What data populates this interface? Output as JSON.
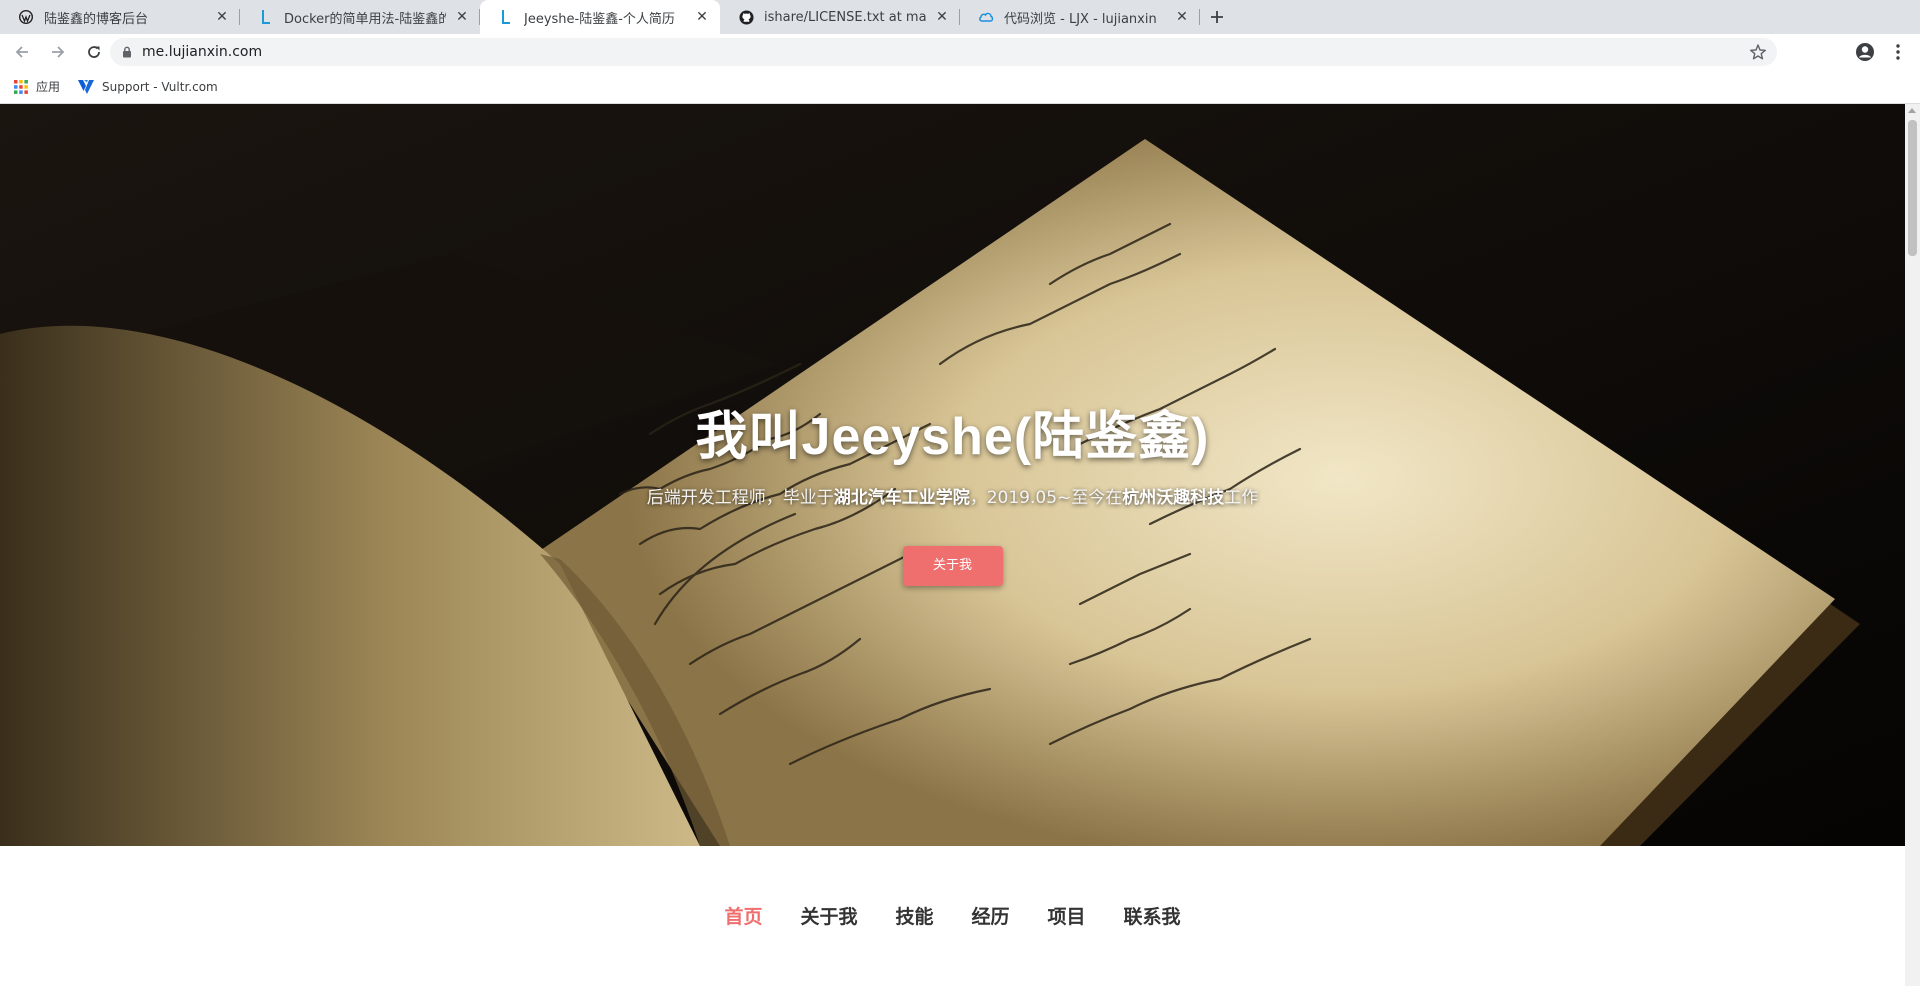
{
  "tabs": [
    {
      "title": "陆鉴鑫的博客后台",
      "icon": "wordpress-icon",
      "active": false
    },
    {
      "title": "Docker的简单用法-陆鉴鑫的博客",
      "icon": "blog-l-icon",
      "active": false
    },
    {
      "title": "Jeeyshe-陆鉴鑫-个人简历",
      "icon": "blog-l-icon",
      "active": true
    },
    {
      "title": "ishare/LICENSE.txt at master · ",
      "icon": "github-icon",
      "active": false
    },
    {
      "title": "代码浏览 - LJX - lujianxin",
      "icon": "cloud-icon",
      "active": false
    }
  ],
  "address": {
    "url": "me.lujianxin.com"
  },
  "bookmarks": [
    {
      "label": "应用",
      "icon": "apps-grid-icon"
    },
    {
      "label": "Support - Vultr.com",
      "icon": "vultr-icon"
    }
  ],
  "hero": {
    "title": "我叫Jeeyshe(陆鉴鑫)",
    "subtitle_prefix": "后端开发工程师，毕业于",
    "subtitle_school": "湖北汽车工业学院",
    "subtitle_mid": "，2019.05~至今在",
    "subtitle_company": "杭州沃趣科技",
    "subtitle_suffix": "工作",
    "button_label": "关于我"
  },
  "nav": {
    "items": [
      {
        "label": "首页",
        "active": true
      },
      {
        "label": "关于我",
        "active": false
      },
      {
        "label": "技能",
        "active": false
      },
      {
        "label": "经历",
        "active": false
      },
      {
        "label": "项目",
        "active": false
      },
      {
        "label": "联系我",
        "active": false
      }
    ]
  },
  "colors": {
    "accent": "#ef6f6f",
    "nav_text": "#333333",
    "tabstrip": "#dee1e6"
  }
}
